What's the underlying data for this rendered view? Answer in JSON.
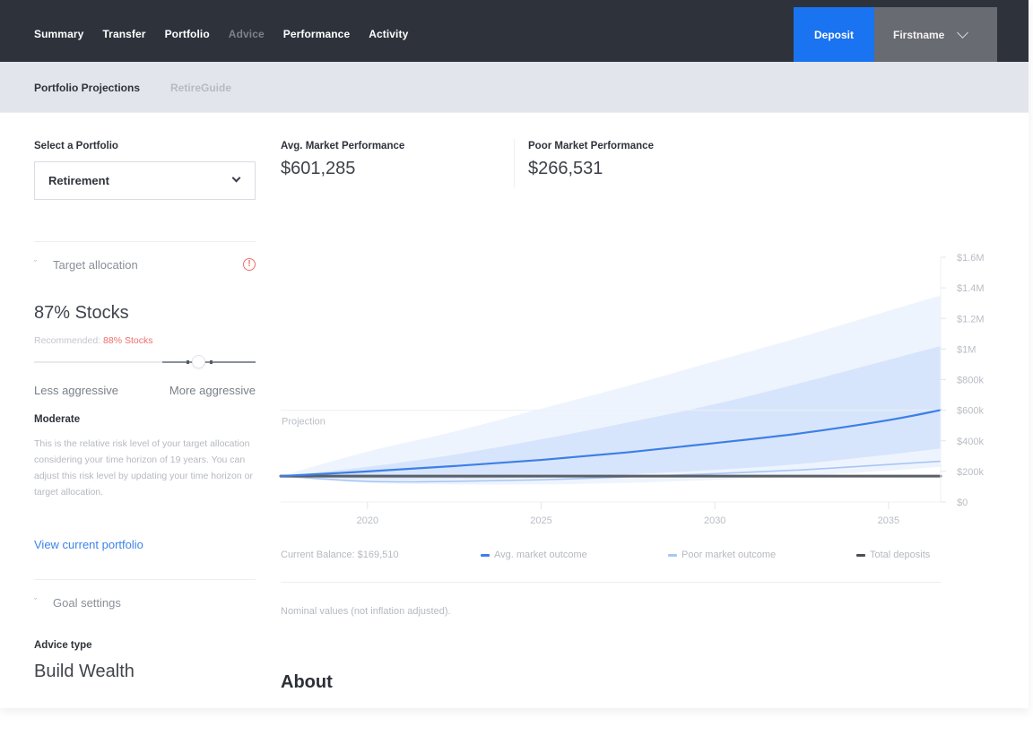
{
  "topnav": {
    "items": [
      {
        "label": "Summary",
        "active": true
      },
      {
        "label": "Transfer",
        "active": true
      },
      {
        "label": "Portfolio",
        "active": true
      },
      {
        "label": "Advice",
        "active": false
      },
      {
        "label": "Performance",
        "active": true
      },
      {
        "label": "Activity",
        "active": true
      }
    ],
    "deposit_label": "Deposit",
    "user_label": "Firstname",
    "user_icon": "chevron-down-icon"
  },
  "subnav": {
    "items": [
      {
        "label": "Portfolio Projections",
        "selected": true
      },
      {
        "label": "RetireGuide",
        "selected": false
      }
    ]
  },
  "left": {
    "select_label": "Select a Portfolio",
    "select_value": "Retirement",
    "target_allocation": {
      "heading": "Target allocation",
      "warning_icon": "!",
      "stocks": "87% Stocks",
      "recommended_prefix": "Recommended: ",
      "recommended_value": "88% Stocks",
      "slider_value_pct": 87,
      "slider_recommended_pct": 88,
      "less_label": "Less aggressive",
      "more_label": "More aggressive",
      "risk_level": "Moderate",
      "risk_description": "This is the relative risk level of your target allocation considering your time horizon of 19 years. You can adjust this risk level by updating your time horizon or target allocation.",
      "view_link": "View current portfolio"
    },
    "goal_settings": {
      "heading": "Goal settings",
      "advice_type_label": "Advice type",
      "advice_type_value": "Build Wealth"
    }
  },
  "stats": {
    "avg": {
      "label": "Avg. Market Performance",
      "value": "$601,285"
    },
    "poor": {
      "label": "Poor Market Performance",
      "value": "$266,531"
    }
  },
  "chart_data": {
    "type": "area",
    "title": "",
    "annotation": "Projection",
    "xlabel": "",
    "ylabel": "",
    "x_ticks": [
      2020,
      2025,
      2030,
      2035
    ],
    "x_tick_labels": [
      "2020",
      "2025",
      "2030",
      "2035"
    ],
    "xlim": [
      2017.5,
      2036.5
    ],
    "y_ticks": [
      0,
      200000,
      400000,
      600000,
      800000,
      1000000,
      1200000,
      1400000,
      1600000
    ],
    "y_tick_labels": [
      "$0",
      "$200k",
      "$400k",
      "$600k",
      "$800k",
      "$1M",
      "$1.2M",
      "$1.4M",
      "$1.6M"
    ],
    "ylim": [
      0,
      1600000
    ],
    "grid": false,
    "x": [
      2017.5,
      2020,
      2022.5,
      2025,
      2027.5,
      2030,
      2032.5,
      2035,
      2036.5
    ],
    "series": [
      {
        "name": "Outer range upper",
        "role": "band-outer-upper",
        "values": [
          169510,
          330000,
          460000,
          610000,
          760000,
          920000,
          1080000,
          1250000,
          1350000
        ]
      },
      {
        "name": "Outer range lower",
        "role": "band-outer-lower",
        "values": [
          169510,
          125000,
          115000,
          115000,
          125000,
          145000,
          170000,
          205000,
          230000
        ]
      },
      {
        "name": "Inner range upper",
        "role": "band-inner-upper",
        "values": [
          169510,
          230000,
          310000,
          410000,
          520000,
          640000,
          780000,
          930000,
          1020000
        ]
      },
      {
        "name": "Inner range lower",
        "role": "band-inner-lower",
        "values": [
          169510,
          150000,
          150000,
          160000,
          180000,
          210000,
          250000,
          310000,
          350000
        ]
      },
      {
        "name": "Avg. market outcome",
        "role": "line",
        "color": "#3d7fe6",
        "values": [
          169510,
          200000,
          235000,
          275000,
          325000,
          385000,
          450000,
          535000,
          601285
        ]
      },
      {
        "name": "Poor market outcome",
        "role": "line",
        "color": "#a8c6f5",
        "values": [
          169510,
          135000,
          135000,
          145000,
          165000,
          185000,
          210000,
          245000,
          266531
        ]
      },
      {
        "name": "Total deposits",
        "role": "line",
        "color": "#5b5f66",
        "values": [
          169510,
          169510,
          169510,
          169510,
          169510,
          169510,
          169510,
          169510,
          169510
        ]
      }
    ],
    "colors": {
      "band_outer": "#eef4fe",
      "band_inner": "#d7e5fc"
    },
    "legend": [
      {
        "label": "Avg. market outcome",
        "color": "#3d7fe6"
      },
      {
        "label": "Poor market outcome",
        "color": "#a8c6f5"
      },
      {
        "label": "Total deposits",
        "color": "#4a4e55"
      }
    ],
    "legend_position": "bottom"
  },
  "footer": {
    "current_balance": "Current Balance: $169,510",
    "nominal_note": "Nominal values (not inflation adjusted).",
    "about_heading": "About"
  }
}
